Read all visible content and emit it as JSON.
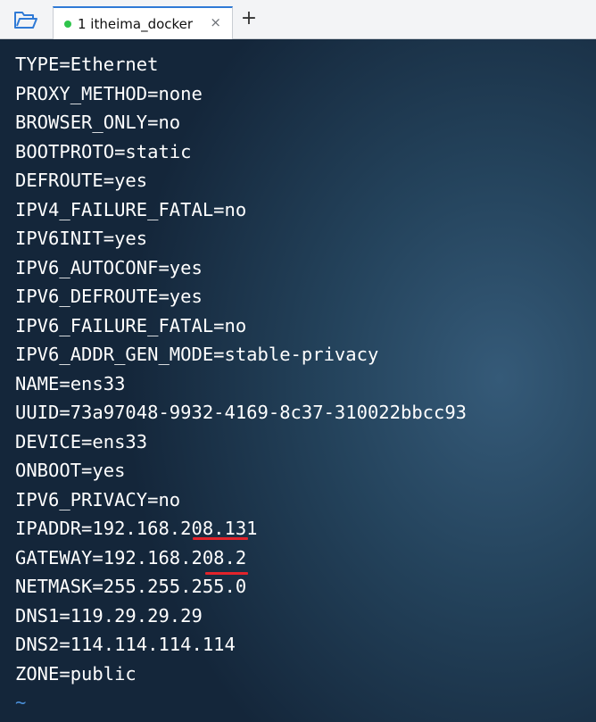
{
  "tabbar": {
    "folder_icon": "folder-open-icon",
    "tab": {
      "label": "1 itheima_docker",
      "status_color": "#2ec44b",
      "close_glyph": "×"
    },
    "new_tab_glyph": "+"
  },
  "terminal": {
    "lines": [
      "TYPE=Ethernet",
      "PROXY_METHOD=none",
      "BROWSER_ONLY=no",
      "BOOTPROTO=static",
      "DEFROUTE=yes",
      "IPV4_FAILURE_FATAL=no",
      "IPV6INIT=yes",
      "IPV6_AUTOCONF=yes",
      "IPV6_DEFROUTE=yes",
      "IPV6_FAILURE_FATAL=no",
      "IPV6_ADDR_GEN_MODE=stable-privacy",
      "NAME=ens33",
      "UUID=73a97048-9932-4169-8c37-310022bbcc93",
      "DEVICE=ens33",
      "ONBOOT=yes",
      "IPV6_PRIVACY=no",
      "IPADDR=192.168.208.131",
      "GATEWAY=192.168.208.2",
      "NETMASK=255.255.255.0",
      "DNS1=119.29.29.29",
      "DNS2=114.114.114.114",
      "ZONE=public"
    ],
    "empty_line_marker": "~",
    "highlight_color": "#e2232b"
  }
}
